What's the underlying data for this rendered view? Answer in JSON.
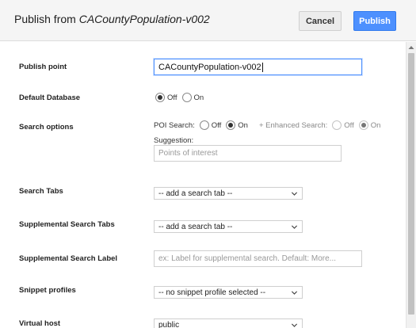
{
  "header": {
    "title_prefix": "Publish from ",
    "title_name": "CACountyPopulation-v002",
    "cancel_label": "Cancel",
    "publish_label": "Publish"
  },
  "form": {
    "publish_point": {
      "label": "Publish point",
      "value": "CACountyPopulation-v002"
    },
    "default_database": {
      "label": "Default Database",
      "off_label": "Off",
      "on_label": "On",
      "selected": "Off"
    },
    "search_options": {
      "label": "Search options",
      "poi_label": "POI Search:",
      "poi_off": "Off",
      "poi_on": "On",
      "poi_selected": "On",
      "enhanced_label": "+ Enhanced Search:",
      "enhanced_off": "Off",
      "enhanced_on": "On",
      "enhanced_selected": "On",
      "suggestion_label": "Suggestion:",
      "suggestion_placeholder": "Points of interest"
    },
    "search_tabs": {
      "label": "Search Tabs",
      "selected": "-- add a search tab --"
    },
    "supplemental_search_tabs": {
      "label": "Supplemental Search Tabs",
      "selected": "-- add a search tab --"
    },
    "supplemental_search_label": {
      "label": "Supplemental Search Label",
      "placeholder": "ex: Label for supplemental search.  Default: More..."
    },
    "snippet_profiles": {
      "label": "Snippet profiles",
      "selected": "-- no snippet profile selected --"
    },
    "virtual_host": {
      "label": "Virtual host",
      "selected": "public"
    }
  },
  "icons": {
    "dropdown": "chevron-down-icon",
    "scroll_up": "scroll-up-arrow-icon"
  }
}
